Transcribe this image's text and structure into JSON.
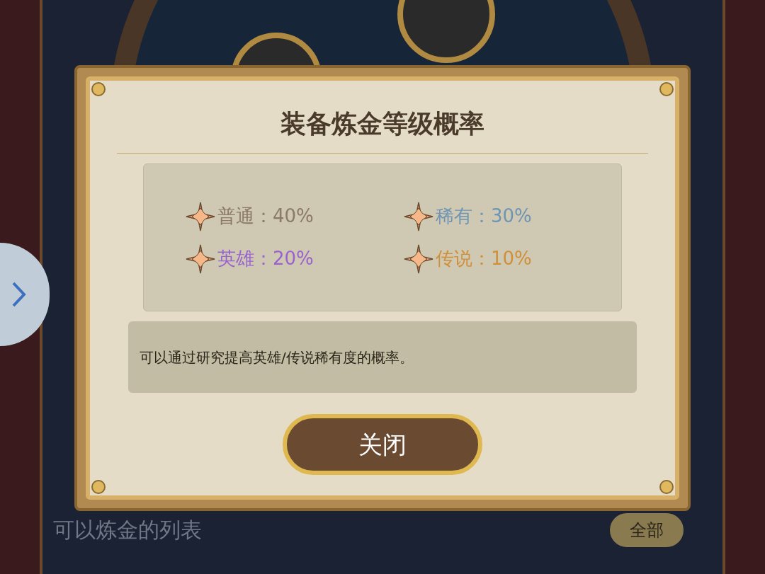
{
  "dialog": {
    "title": "装备炼金等级概率",
    "rates": [
      {
        "label": "普通：40%",
        "color": "#8c7a68"
      },
      {
        "label": "稀有：30%",
        "color": "#6f95b5"
      },
      {
        "label": "英雄：20%",
        "color": "#9a62d0"
      },
      {
        "label": "传说：10%",
        "color": "#d0903a"
      }
    ],
    "note": "可以通过研究提高英雄/传说稀有度的概率。",
    "close_button": "关闭"
  },
  "background": {
    "list_title": "可以炼金的列表",
    "filter_button": "全部"
  }
}
